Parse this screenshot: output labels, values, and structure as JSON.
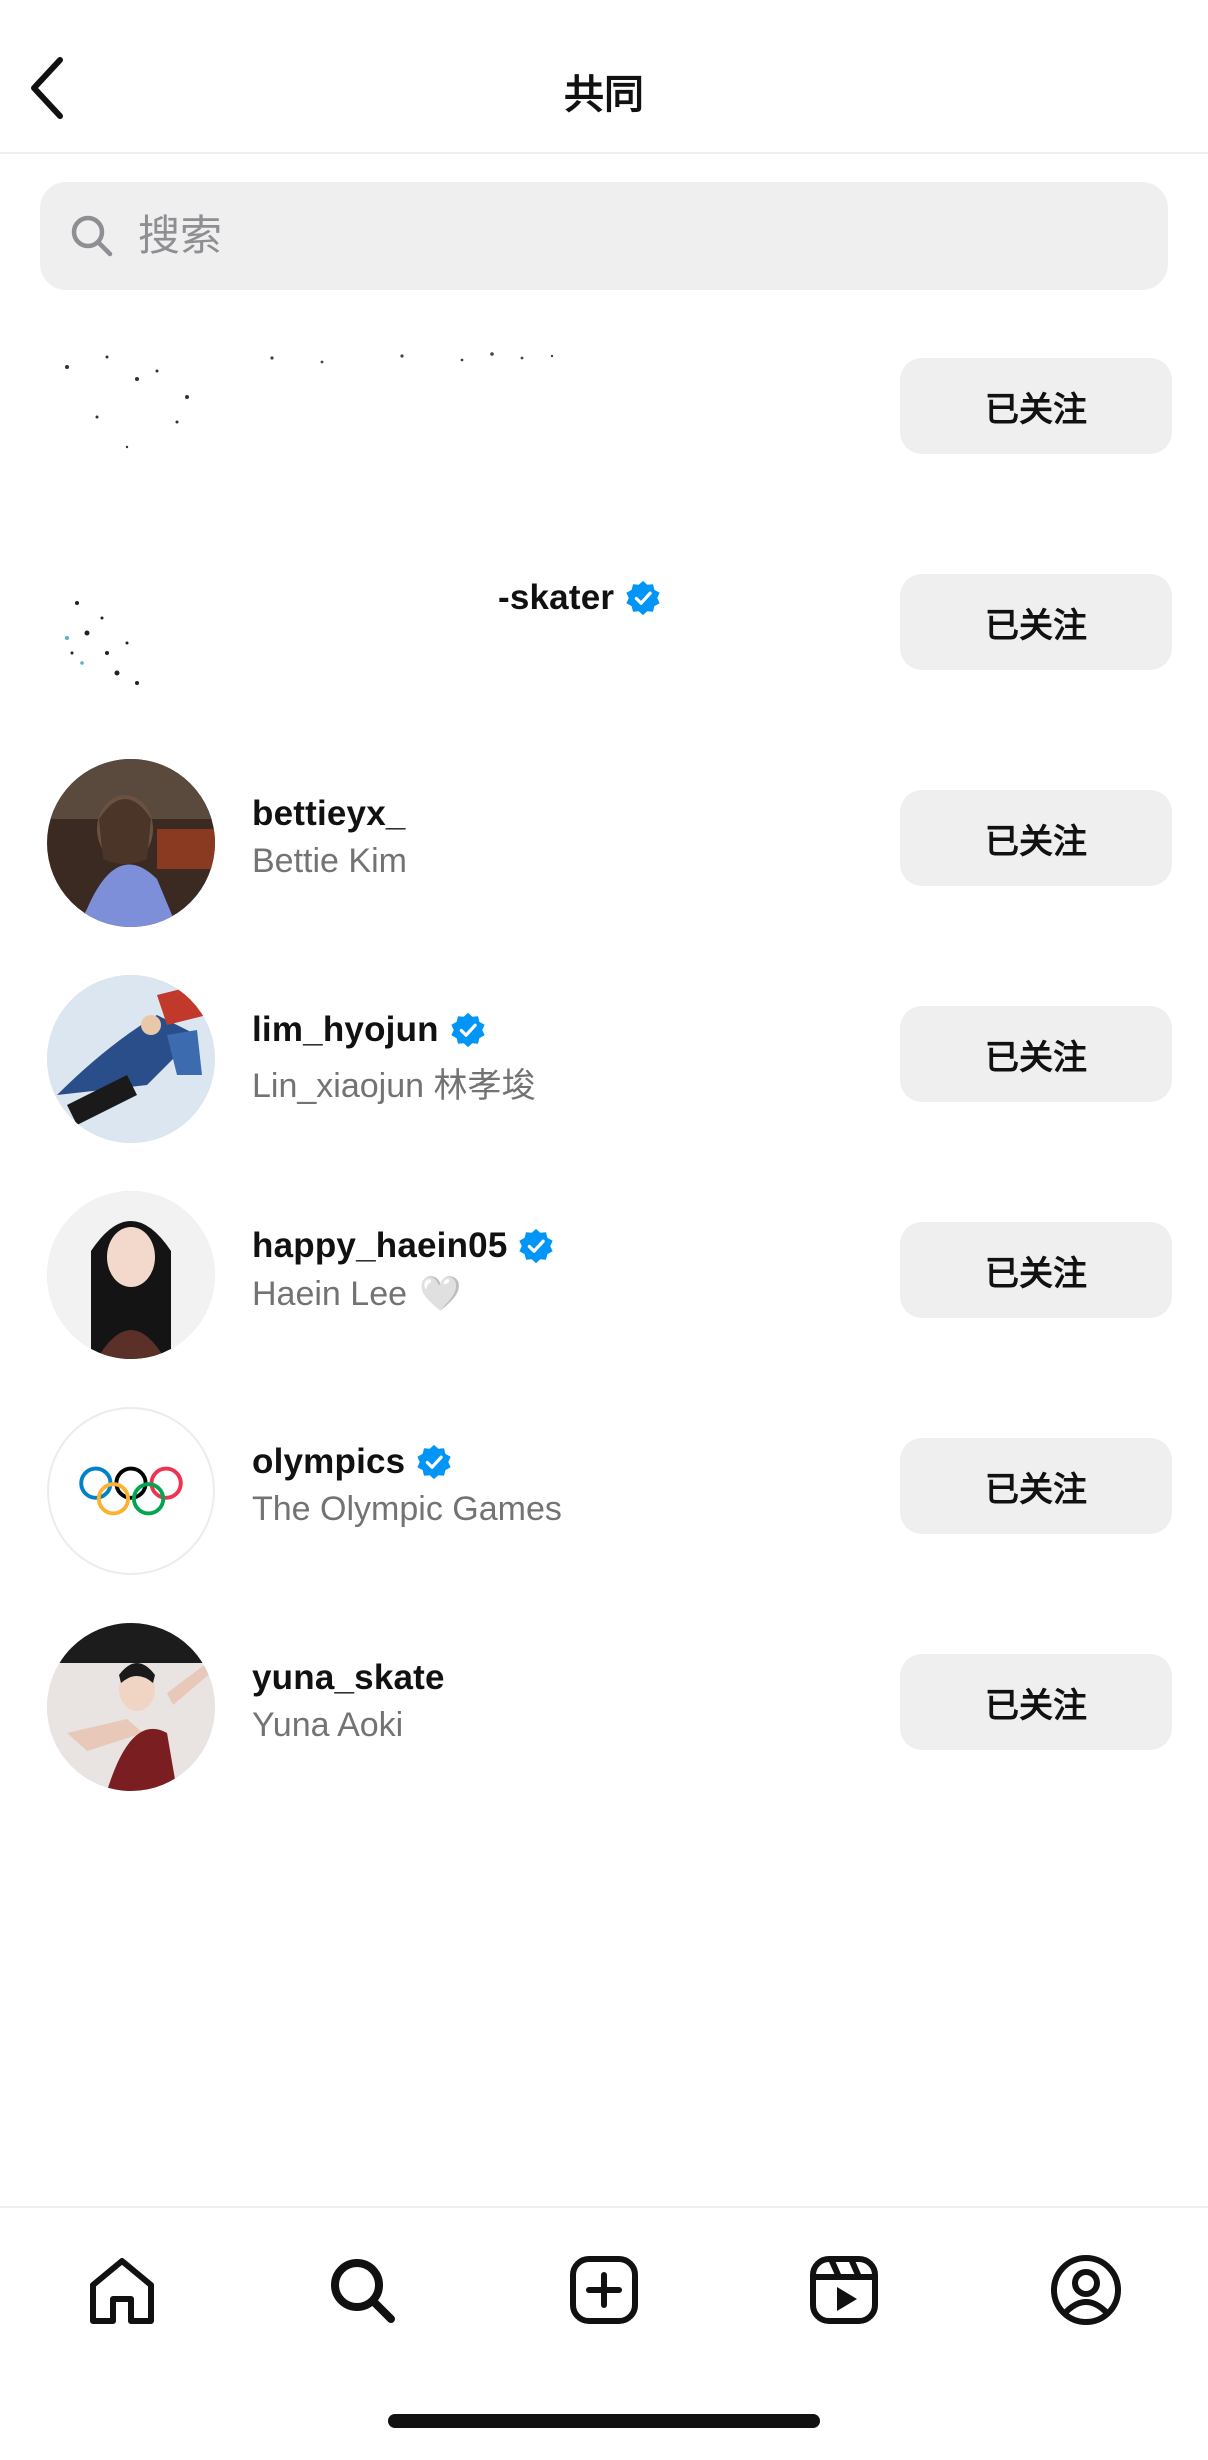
{
  "header": {
    "title": "共同"
  },
  "search": {
    "placeholder": "搜索",
    "value": ""
  },
  "follow_label": "已关注",
  "accounts": [
    {
      "username": "",
      "fullname": "",
      "verified": false,
      "redacted": true
    },
    {
      "username": "-skater",
      "fullname": "",
      "verified": true,
      "redacted": true
    },
    {
      "username": "bettieyx_",
      "fullname": "Bettie Kim",
      "verified": false
    },
    {
      "username": "lim_hyojun",
      "fullname": "Lin_xiaojun 林孝埈",
      "verified": true
    },
    {
      "username": "happy_haein05",
      "fullname": "Haein Lee",
      "verified": true,
      "fullname_emoji": "🤍"
    },
    {
      "username": "olympics",
      "fullname": "The Olympic Games",
      "verified": true
    },
    {
      "username": "yuna_skate",
      "fullname": "Yuna Aoki",
      "verified": false
    }
  ],
  "bottom_nav": [
    "home-icon",
    "search-icon",
    "create-icon",
    "reels-icon",
    "profile-icon"
  ],
  "colors": {
    "verified_blue": "#0095f6",
    "button_bg": "#efeff0",
    "secondary_text": "#737373"
  }
}
